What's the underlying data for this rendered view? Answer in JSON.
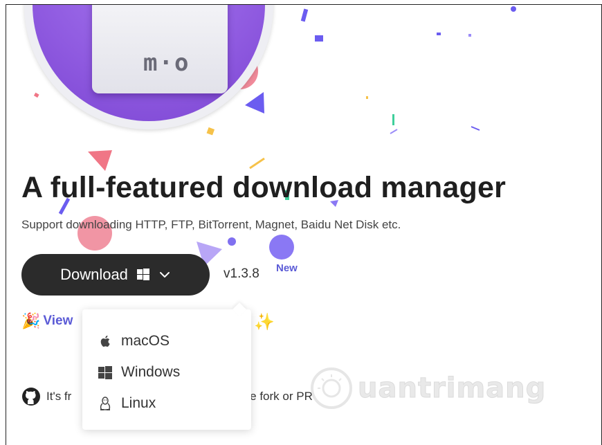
{
  "hero": {
    "logo_text": "m·o",
    "headline": "A full-featured download manager",
    "subline": "Support downloading HTTP, FTP, BitTorrent, Magnet, Baidu Net Disk etc."
  },
  "download": {
    "label": "Download",
    "selected_platform_icon": "windows-icon",
    "version": "v1.3.8",
    "badge": "New"
  },
  "platform_menu": {
    "items": [
      {
        "label": "macOS",
        "icon": "apple-icon"
      },
      {
        "label": "Windows",
        "icon": "windows-icon"
      },
      {
        "label": "Linux",
        "icon": "linux-icon"
      }
    ]
  },
  "links": {
    "view_text": "View",
    "view_icon": "party-popper-icon",
    "sparkle_icon": "sparkles-icon"
  },
  "footer": {
    "free_text_start": "It's fr",
    "free_text_end": "me fork or PR",
    "github_icon": "github-icon"
  },
  "watermark": {
    "text": "uantrimang"
  },
  "colors": {
    "accent": "#5b5bd6",
    "button_bg": "#2b2b2b",
    "logo_purple": "#8f5ae0"
  }
}
